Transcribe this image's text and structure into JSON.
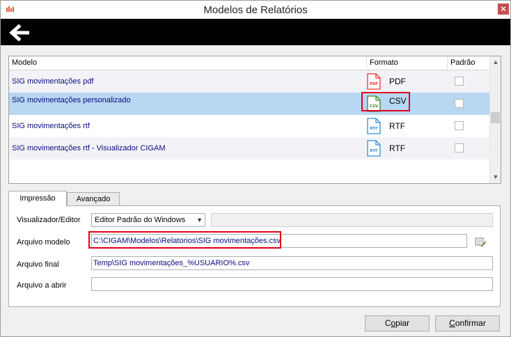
{
  "window": {
    "title": "Modelos de Relatórios",
    "close": "×"
  },
  "grid": {
    "columns": {
      "model": "Modelo",
      "format": "Formato",
      "default": "Padrão"
    },
    "rows": [
      {
        "model": "SIG movimentações pdf",
        "format": "PDF",
        "icon_text": "PDF",
        "icon_color": "#e8372b",
        "default": false
      },
      {
        "model": "SIG movimentações personalizado",
        "format": "CSV",
        "icon_text": "CSV",
        "icon_color": "#3a8a2a",
        "default": false,
        "selected": true
      },
      {
        "model": "SIG movimentações rtf",
        "format": "RTF",
        "icon_text": "RTF",
        "icon_color": "#2f8fd8",
        "default": false
      },
      {
        "model": "SIG movimentações rtf - Visualizador CIGAM",
        "format": "RTF",
        "icon_text": "RTF",
        "icon_color": "#2f8fd8",
        "default": false
      }
    ]
  },
  "tabs": {
    "impressao": "Impressão",
    "avancado": "Avançado"
  },
  "form": {
    "viewer_label": "Visualizador/Editor",
    "viewer_value": "Editor Padrão do Windows",
    "model_file_label": "Arquivo modelo",
    "model_file_value": "C:\\CIGAM\\Modelos\\Relatorios\\SIG movimentações.csv",
    "final_file_label": "Arquivo final",
    "final_file_value": "Temp\\SIG movimentações_%USUARIO%.csv",
    "open_file_label": "Arquivo a abrir",
    "open_file_value": ""
  },
  "buttons": {
    "copy_pre": "C",
    "copy_u": "o",
    "copy_post": "piar",
    "confirm_pre": "",
    "confirm_u": "C",
    "confirm_post": "onfirmar"
  },
  "colors": {
    "highlight": "#e2001a",
    "selected_row": "#b7d7f3",
    "link_text": "#0a0a80"
  }
}
